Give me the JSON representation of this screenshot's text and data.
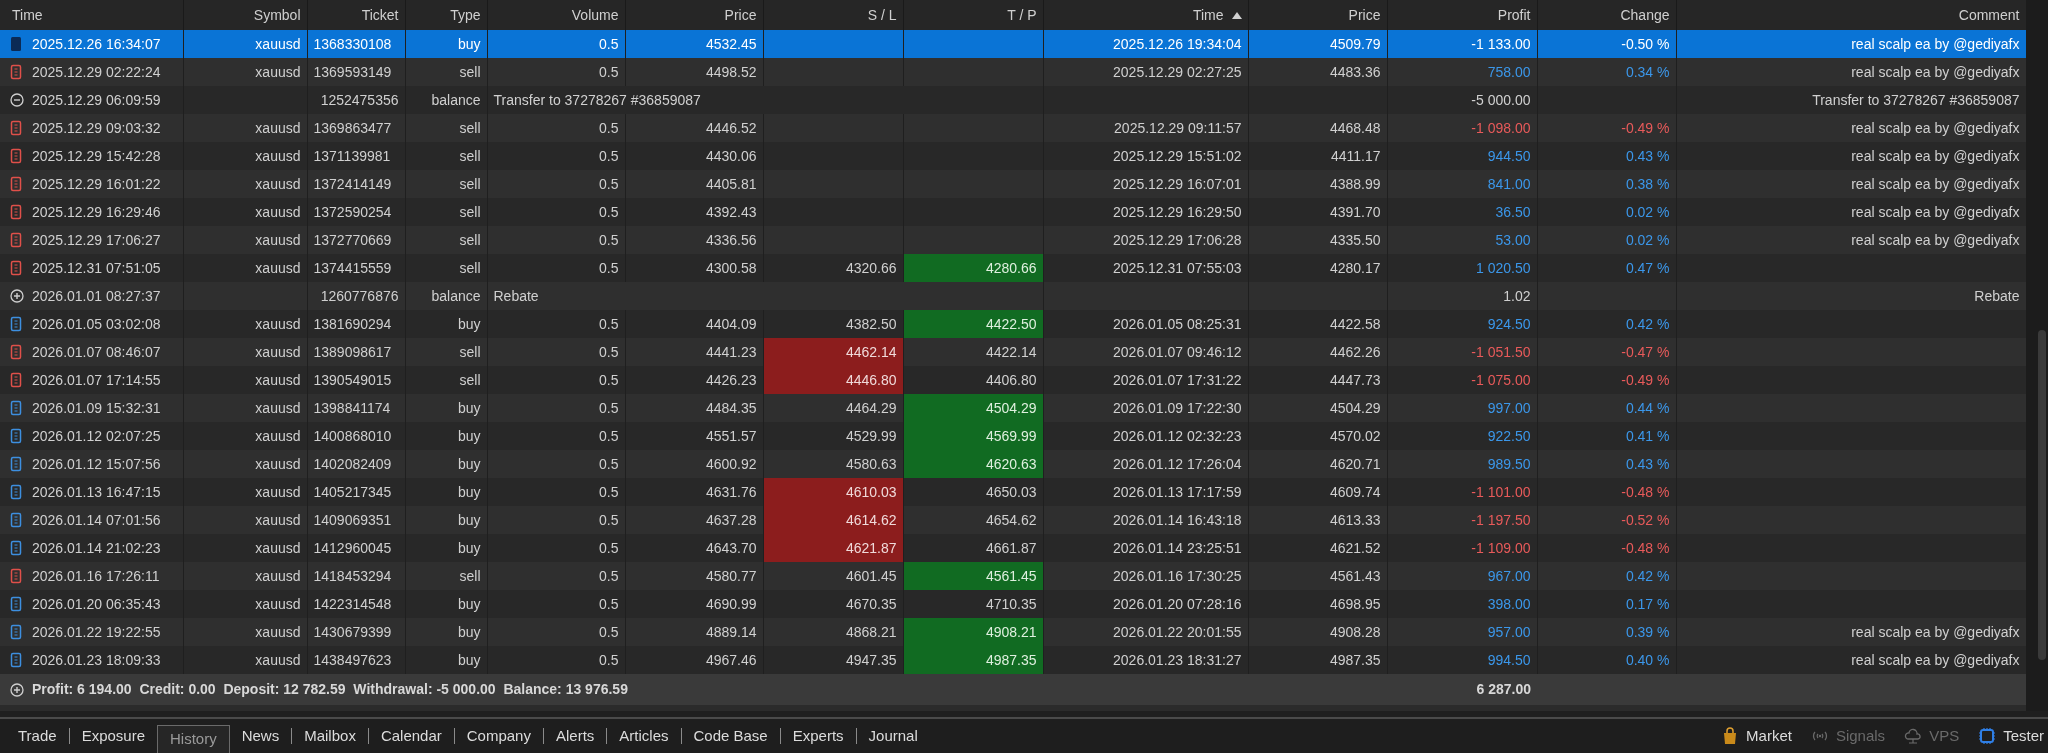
{
  "table": {
    "columns": [
      {
        "label": "Time",
        "sorted": false
      },
      {
        "label": "Symbol",
        "sorted": false
      },
      {
        "label": "Ticket",
        "sorted": false
      },
      {
        "label": "Type",
        "sorted": false
      },
      {
        "label": "Volume",
        "sorted": false
      },
      {
        "label": "Price",
        "sorted": false
      },
      {
        "label": "S / L",
        "sorted": false
      },
      {
        "label": "T / P",
        "sorted": false
      },
      {
        "label": "Time",
        "sorted": true
      },
      {
        "label": "Price",
        "sorted": false
      },
      {
        "label": "Profit",
        "sorted": false
      },
      {
        "label": "Change",
        "sorted": false
      },
      {
        "label": "Comment",
        "sorted": false
      }
    ],
    "rows": [
      {
        "kind": "buy",
        "selected": true,
        "time": "2025.12.26 16:34:07",
        "symbol": "xauusd",
        "ticket": "1368330108",
        "type": "buy",
        "volume": "0.5",
        "price": "4532.45",
        "sl_hit": false,
        "tp_hit": false,
        "close_time": "2025.12.26 19:34:04",
        "close_price": "4509.79",
        "profit": "-1 133.00",
        "change": "-0.50 %",
        "comment": "real scalp ea by @gediyafx"
      },
      {
        "kind": "sell",
        "selected": false,
        "time": "2025.12.29 02:22:24",
        "symbol": "xauusd",
        "ticket": "1369593149",
        "type": "sell",
        "volume": "0.5",
        "price": "4498.52",
        "sl_hit": false,
        "tp_hit": false,
        "close_time": "2025.12.29 02:27:25",
        "close_price": "4483.36",
        "profit": "758.00",
        "loss": false,
        "change": "0.34 %",
        "comment": "real scalp ea by @gediyafx"
      },
      {
        "kind": "withdrawal",
        "selected": false,
        "time": "2025.12.29 06:09:59",
        "ticket": "1252475356",
        "type": "balance",
        "description": "Transfer to 37278267 #36859087",
        "profit": "-5 000.00",
        "comment": "Transfer to 37278267 #36859087"
      },
      {
        "kind": "sell",
        "selected": false,
        "time": "2025.12.29 09:03:32",
        "symbol": "xauusd",
        "ticket": "1369863477",
        "type": "sell",
        "volume": "0.5",
        "price": "4446.52",
        "sl_hit": false,
        "tp_hit": false,
        "close_time": "2025.12.29 09:11:57",
        "close_price": "4468.48",
        "profit": "-1 098.00",
        "loss": true,
        "change": "-0.49 %",
        "comment": "real scalp ea by @gediyafx"
      },
      {
        "kind": "sell",
        "selected": false,
        "time": "2025.12.29 15:42:28",
        "symbol": "xauusd",
        "ticket": "1371139981",
        "type": "sell",
        "volume": "0.5",
        "price": "4430.06",
        "sl_hit": false,
        "tp_hit": false,
        "close_time": "2025.12.29 15:51:02",
        "close_price": "4411.17",
        "profit": "944.50",
        "loss": false,
        "change": "0.43 %",
        "comment": "real scalp ea by @gediyafx"
      },
      {
        "kind": "sell",
        "selected": false,
        "time": "2025.12.29 16:01:22",
        "symbol": "xauusd",
        "ticket": "1372414149",
        "type": "sell",
        "volume": "0.5",
        "price": "4405.81",
        "sl_hit": false,
        "tp_hit": false,
        "close_time": "2025.12.29 16:07:01",
        "close_price": "4388.99",
        "profit": "841.00",
        "loss": false,
        "change": "0.38 %",
        "comment": "real scalp ea by @gediyafx"
      },
      {
        "kind": "sell",
        "selected": false,
        "time": "2025.12.29 16:29:46",
        "symbol": "xauusd",
        "ticket": "1372590254",
        "type": "sell",
        "volume": "0.5",
        "price": "4392.43",
        "sl_hit": false,
        "tp_hit": false,
        "close_time": "2025.12.29 16:29:50",
        "close_price": "4391.70",
        "profit": "36.50",
        "loss": false,
        "change": "0.02 %",
        "comment": "real scalp ea by @gediyafx"
      },
      {
        "kind": "sell",
        "selected": false,
        "time": "2025.12.29 17:06:27",
        "symbol": "xauusd",
        "ticket": "1372770669",
        "type": "sell",
        "volume": "0.5",
        "price": "4336.56",
        "sl_hit": false,
        "tp_hit": false,
        "close_time": "2025.12.29 17:06:28",
        "close_price": "4335.50",
        "profit": "53.00",
        "loss": false,
        "change": "0.02 %",
        "comment": "real scalp ea by @gediyafx"
      },
      {
        "kind": "sell",
        "selected": false,
        "time": "2025.12.31 07:51:05",
        "symbol": "xauusd",
        "ticket": "1374415559",
        "type": "sell",
        "volume": "0.5",
        "price": "4300.58",
        "sl": "4320.66",
        "tp": "4280.66",
        "sl_hit": false,
        "tp_hit": true,
        "close_time": "2025.12.31 07:55:03",
        "close_price": "4280.17",
        "profit": "1 020.50",
        "loss": false,
        "change": "0.47 %"
      },
      {
        "kind": "deposit",
        "selected": false,
        "time": "2026.01.01 08:27:37",
        "ticket": "1260776876",
        "type": "balance",
        "description": "Rebate",
        "profit": "1.02",
        "comment": "Rebate"
      },
      {
        "kind": "buy",
        "selected": false,
        "time": "2026.01.05 03:02:08",
        "symbol": "xauusd",
        "ticket": "1381690294",
        "type": "buy",
        "volume": "0.5",
        "price": "4404.09",
        "sl": "4382.50",
        "tp": "4422.50",
        "sl_hit": false,
        "tp_hit": true,
        "close_time": "2026.01.05 08:25:31",
        "close_price": "4422.58",
        "profit": "924.50",
        "loss": false,
        "change": "0.42 %"
      },
      {
        "kind": "sell",
        "selected": false,
        "time": "2026.01.07 08:46:07",
        "symbol": "xauusd",
        "ticket": "1389098617",
        "type": "sell",
        "volume": "0.5",
        "price": "4441.23",
        "sl": "4462.14",
        "tp": "4422.14",
        "sl_hit": true,
        "tp_hit": false,
        "close_time": "2026.01.07 09:46:12",
        "close_price": "4462.26",
        "profit": "-1 051.50",
        "loss": true,
        "change": "-0.47 %"
      },
      {
        "kind": "sell",
        "selected": false,
        "time": "2026.01.07 17:14:55",
        "symbol": "xauusd",
        "ticket": "1390549015",
        "type": "sell",
        "volume": "0.5",
        "price": "4426.23",
        "sl": "4446.80",
        "tp": "4406.80",
        "sl_hit": true,
        "tp_hit": false,
        "close_time": "2026.01.07 17:31:22",
        "close_price": "4447.73",
        "profit": "-1 075.00",
        "loss": true,
        "change": "-0.49 %"
      },
      {
        "kind": "buy",
        "selected": false,
        "time": "2026.01.09 15:32:31",
        "symbol": "xauusd",
        "ticket": "1398841174",
        "type": "buy",
        "volume": "0.5",
        "price": "4484.35",
        "sl": "4464.29",
        "tp": "4504.29",
        "sl_hit": false,
        "tp_hit": true,
        "close_time": "2026.01.09 17:22:30",
        "close_price": "4504.29",
        "profit": "997.00",
        "loss": false,
        "change": "0.44 %"
      },
      {
        "kind": "buy",
        "selected": false,
        "time": "2026.01.12 02:07:25",
        "symbol": "xauusd",
        "ticket": "1400868010",
        "type": "buy",
        "volume": "0.5",
        "price": "4551.57",
        "sl": "4529.99",
        "tp": "4569.99",
        "sl_hit": false,
        "tp_hit": true,
        "close_time": "2026.01.12 02:32:23",
        "close_price": "4570.02",
        "profit": "922.50",
        "loss": false,
        "change": "0.41 %"
      },
      {
        "kind": "buy",
        "selected": false,
        "time": "2026.01.12 15:07:56",
        "symbol": "xauusd",
        "ticket": "1402082409",
        "type": "buy",
        "volume": "0.5",
        "price": "4600.92",
        "sl": "4580.63",
        "tp": "4620.63",
        "sl_hit": false,
        "tp_hit": true,
        "close_time": "2026.01.12 17:26:04",
        "close_price": "4620.71",
        "profit": "989.50",
        "loss": false,
        "change": "0.43 %"
      },
      {
        "kind": "buy",
        "selected": false,
        "time": "2026.01.13 16:47:15",
        "symbol": "xauusd",
        "ticket": "1405217345",
        "type": "buy",
        "volume": "0.5",
        "price": "4631.76",
        "sl": "4610.03",
        "tp": "4650.03",
        "sl_hit": true,
        "tp_hit": false,
        "close_time": "2026.01.13 17:17:59",
        "close_price": "4609.74",
        "profit": "-1 101.00",
        "loss": true,
        "change": "-0.48 %"
      },
      {
        "kind": "buy",
        "selected": false,
        "time": "2026.01.14 07:01:56",
        "symbol": "xauusd",
        "ticket": "1409069351",
        "type": "buy",
        "volume": "0.5",
        "price": "4637.28",
        "sl": "4614.62",
        "tp": "4654.62",
        "sl_hit": true,
        "tp_hit": false,
        "close_time": "2026.01.14 16:43:18",
        "close_price": "4613.33",
        "profit": "-1 197.50",
        "loss": true,
        "change": "-0.52 %"
      },
      {
        "kind": "buy",
        "selected": false,
        "time": "2026.01.14 21:02:23",
        "symbol": "xauusd",
        "ticket": "1412960045",
        "type": "buy",
        "volume": "0.5",
        "price": "4643.70",
        "sl": "4621.87",
        "tp": "4661.87",
        "sl_hit": true,
        "tp_hit": false,
        "close_time": "2026.01.14 23:25:51",
        "close_price": "4621.52",
        "profit": "-1 109.00",
        "loss": true,
        "change": "-0.48 %"
      },
      {
        "kind": "sell",
        "selected": false,
        "time": "2026.01.16 17:26:11",
        "symbol": "xauusd",
        "ticket": "1418453294",
        "type": "sell",
        "volume": "0.5",
        "price": "4580.77",
        "sl": "4601.45",
        "tp": "4561.45",
        "sl_hit": false,
        "tp_hit": true,
        "close_time": "2026.01.16 17:30:25",
        "close_price": "4561.43",
        "profit": "967.00",
        "loss": false,
        "change": "0.42 %"
      },
      {
        "kind": "buy",
        "selected": false,
        "time": "2026.01.20 06:35:43",
        "symbol": "xauusd",
        "ticket": "1422314548",
        "type": "buy",
        "volume": "0.5",
        "price": "4690.99",
        "sl": "4670.35",
        "tp": "4710.35",
        "sl_hit": false,
        "tp_hit": false,
        "close_time": "2026.01.20 07:28:16",
        "close_price": "4698.95",
        "profit": "398.00",
        "loss": false,
        "change": "0.17 %"
      },
      {
        "kind": "buy",
        "selected": false,
        "time": "2026.01.22 19:22:55",
        "symbol": "xauusd",
        "ticket": "1430679399",
        "type": "buy",
        "volume": "0.5",
        "price": "4889.14",
        "sl": "4868.21",
        "tp": "4908.21",
        "sl_hit": false,
        "tp_hit": true,
        "close_time": "2026.01.22 20:01:55",
        "close_price": "4908.28",
        "profit": "957.00",
        "loss": false,
        "change": "0.39 %",
        "comment": "real scalp ea by @gediyafx"
      },
      {
        "kind": "buy",
        "selected": false,
        "time": "2026.01.23 18:09:33",
        "symbol": "xauusd",
        "ticket": "1438497623",
        "type": "buy",
        "volume": "0.5",
        "price": "4967.46",
        "sl": "4947.35",
        "tp": "4987.35",
        "sl_hit": false,
        "tp_hit": true,
        "close_time": "2026.01.23 18:31:27",
        "close_price": "4987.35",
        "profit": "994.50",
        "loss": false,
        "change": "0.40 %",
        "comment": "real scalp ea by @gediyafx"
      }
    ],
    "summary": {
      "text": "Profit: 6 194.00  Credit: 0.00  Deposit: 12 782.59  Withdrawal: -5 000.00  Balance: 13 976.59",
      "profit": "6 287.00"
    }
  },
  "tabs": [
    {
      "label": "Trade",
      "selected": false
    },
    {
      "label": "Exposure",
      "selected": false
    },
    {
      "label": "History",
      "selected": true
    },
    {
      "label": "News",
      "selected": false
    },
    {
      "label": "Mailbox",
      "selected": false
    },
    {
      "label": "Calendar",
      "selected": false
    },
    {
      "label": "Company",
      "selected": false
    },
    {
      "label": "Alerts",
      "selected": false
    },
    {
      "label": "Articles",
      "selected": false
    },
    {
      "label": "Code Base",
      "selected": false
    },
    {
      "label": "Experts",
      "selected": false
    },
    {
      "label": "Journal",
      "selected": false
    }
  ],
  "services": [
    {
      "kind": "market",
      "label": "Market",
      "disabled": false
    },
    {
      "kind": "signals",
      "label": "Signals",
      "disabled": true
    },
    {
      "kind": "vps",
      "label": "VPS",
      "disabled": true
    },
    {
      "kind": "tester",
      "label": "Tester",
      "disabled": false
    }
  ]
}
